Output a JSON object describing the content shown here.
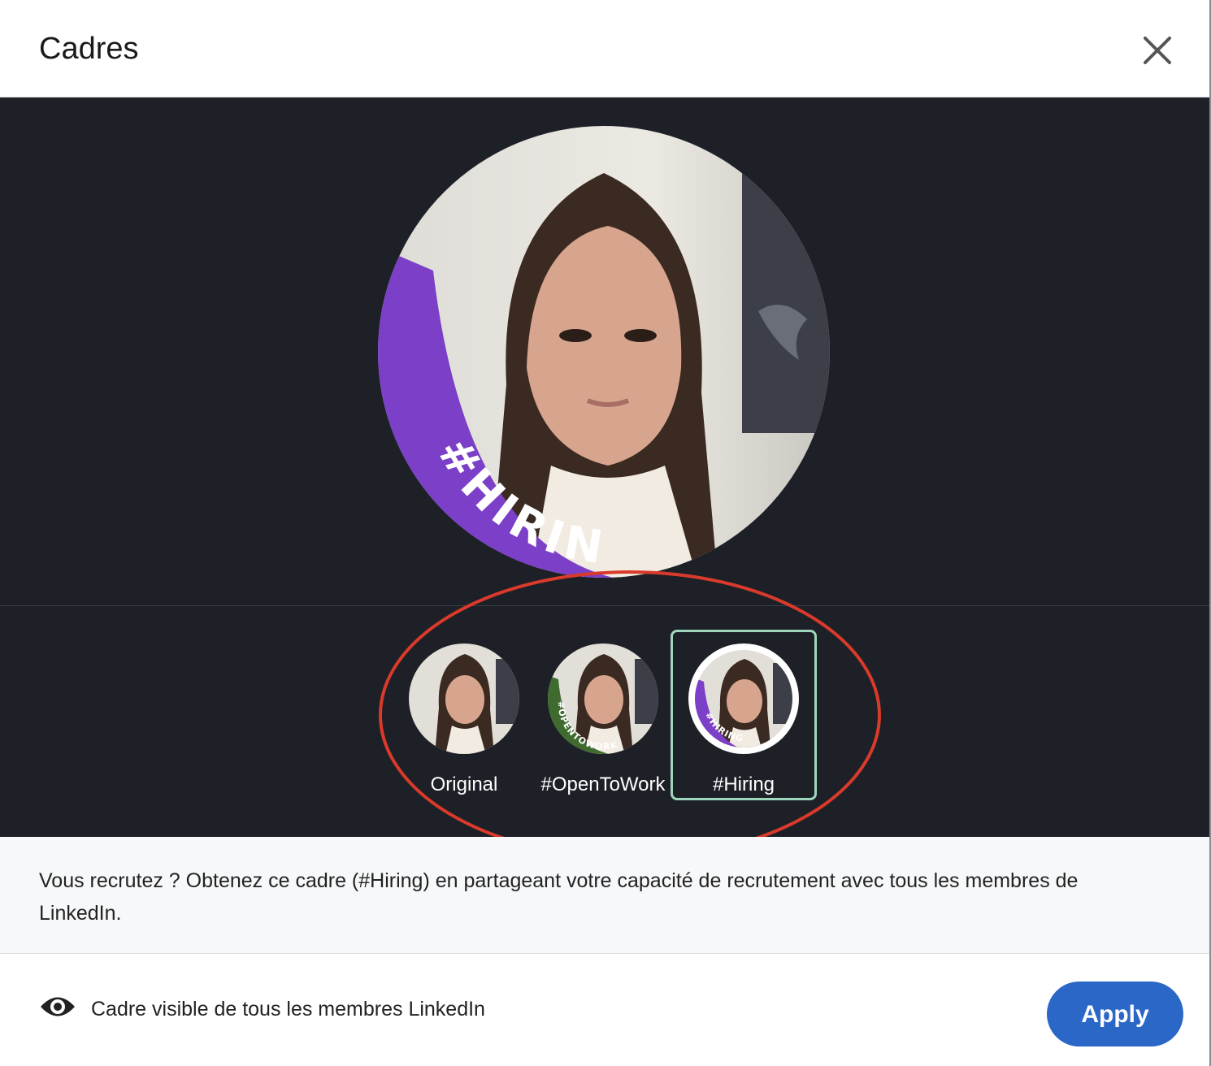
{
  "dialog": {
    "title": "Cadres",
    "close_label": "×"
  },
  "preview": {
    "frame_text": "#HIRING",
    "frame_color": "#7b3fc8"
  },
  "options": [
    {
      "label": "Original",
      "badge": ""
    },
    {
      "label": "#OpenToWork",
      "badge": "#OPENTOWORK",
      "color": "#3f6b2f"
    },
    {
      "label": "#Hiring",
      "badge": "#HIRING",
      "color": "#7b3fc8",
      "selected": true
    }
  ],
  "info": {
    "text": "Vous recrutez ? Obtenez ce cadre (#Hiring) en partageant votre capacité de recrutement avec tous les membres de LinkedIn."
  },
  "footer": {
    "visibility_text": "Cadre visible de tous les membres LinkedIn",
    "apply_label": "Apply"
  },
  "colors": {
    "dark_bg": "#1d2026",
    "accent": "#2a67c7",
    "selected_border": "#9ed6bd",
    "annotation": "#d93a2b"
  },
  "icons": {
    "close": "close-icon",
    "visibility": "eye-icon"
  }
}
